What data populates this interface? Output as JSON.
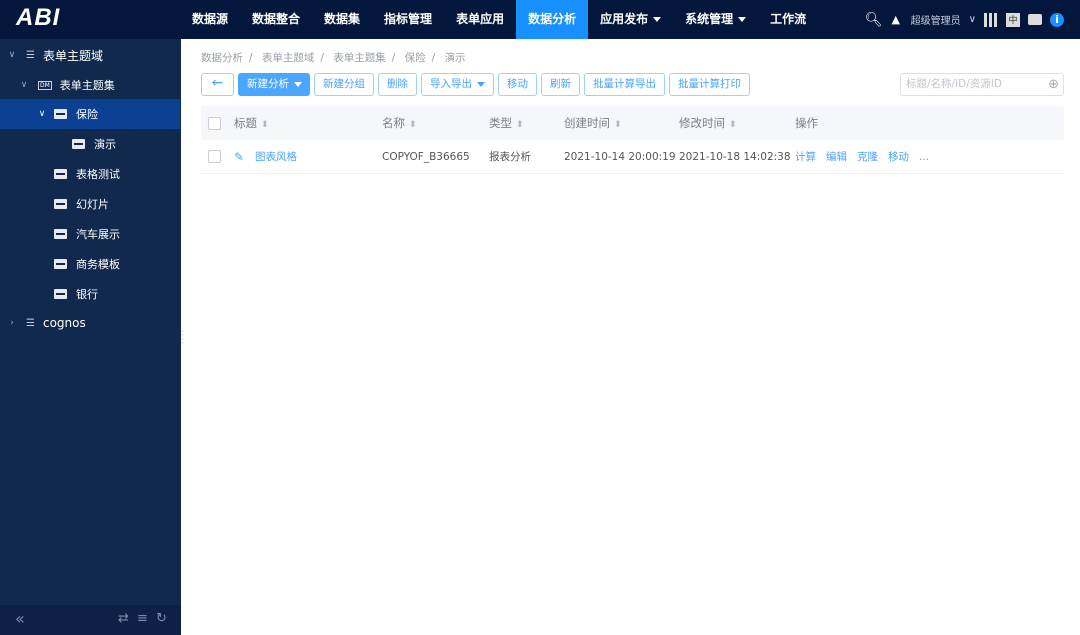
{
  "app": {
    "logo": "ABI"
  },
  "nav": {
    "items": [
      "数据源",
      "数据整合",
      "数据集",
      "指标管理",
      "表单应用",
      "数据分析",
      "应用发布",
      "系统管理",
      "工作流"
    ],
    "active": "数据分析"
  },
  "user": {
    "name": "超级管理员",
    "lang": "中"
  },
  "sidebar": {
    "items": [
      {
        "label": "表单主题域",
        "level": 0,
        "expanded": true
      },
      {
        "label": "表单主题集",
        "level": 1,
        "expanded": true
      },
      {
        "label": "保险",
        "level": 2,
        "expanded": true,
        "selected": true
      },
      {
        "label": "演示",
        "level": 3
      },
      {
        "label": "表格测试",
        "level": 2
      },
      {
        "label": "幻灯片",
        "level": 2
      },
      {
        "label": "汽车展示",
        "level": 2
      },
      {
        "label": "商务模板",
        "level": 2
      },
      {
        "label": "银行",
        "level": 2
      },
      {
        "label": "cognos",
        "level": 0,
        "expanded": false
      }
    ]
  },
  "breadcrumb": [
    "数据分析",
    "表单主题域",
    "表单主题集",
    "保险",
    "演示"
  ],
  "toolbar": {
    "new_analysis": "新建分析",
    "new_group": "新建分组",
    "delete": "删除",
    "import_export": "导入导出",
    "move": "移动",
    "refresh": "刷新",
    "batch_export": "批量计算导出",
    "batch_print": "批量计算打印"
  },
  "search": {
    "placeholder": "标题/名称/ID/资源ID"
  },
  "table": {
    "headers": [
      "标题",
      "名称",
      "类型",
      "创建时间",
      "修改时间",
      "操作"
    ],
    "rows": [
      {
        "title": "图表风格",
        "name": "COPYOF_B36665",
        "type": "报表分析",
        "created": "2021-10-14 20:00:19",
        "modified": "2021-10-18 14:02:38",
        "actions": [
          "计算",
          "编辑",
          "克隆",
          "移动",
          "..."
        ]
      }
    ]
  },
  "colors": {
    "topbar": "#02173b",
    "sidebar": "#12294e",
    "accent": "#1890ff",
    "selected": "#0b4092"
  }
}
